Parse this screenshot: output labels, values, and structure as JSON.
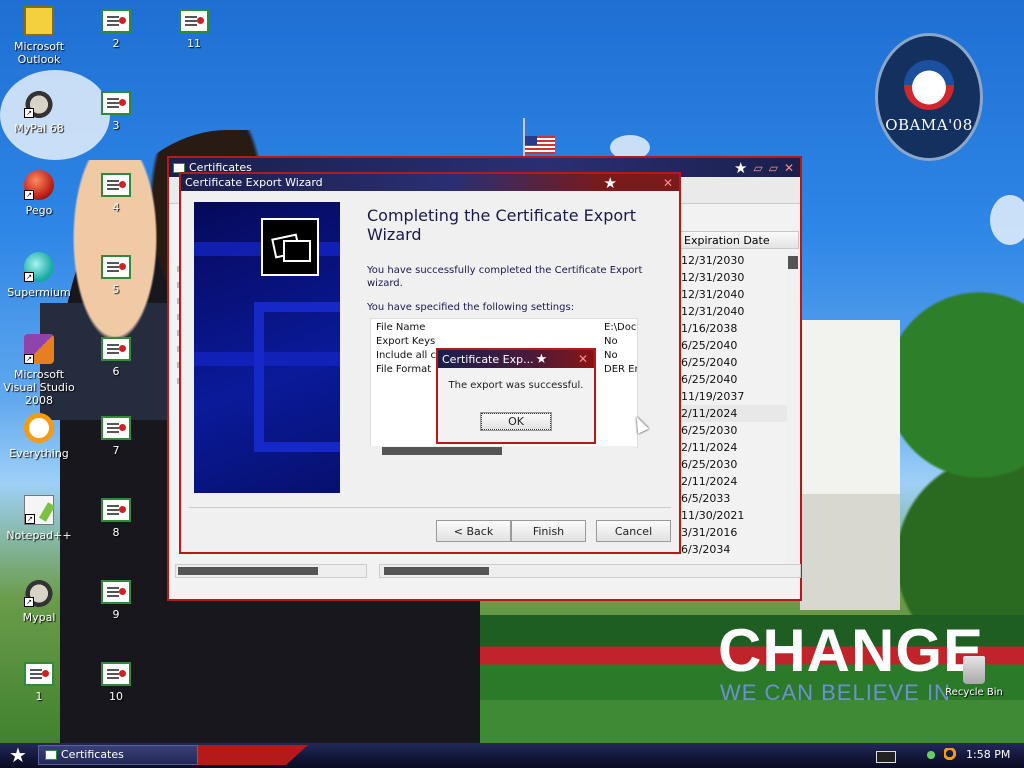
{
  "desktop": {
    "icons_col1": [
      {
        "label": "Microsoft Outlook",
        "icon": "outlook-icon"
      },
      {
        "label": "MyPal 68",
        "icon": "mypal-icon"
      },
      {
        "label": "Pego",
        "icon": "pego-icon"
      },
      {
        "label": "Supermium",
        "icon": "supermium-icon"
      },
      {
        "label": "Microsoft Visual Studio 2008",
        "icon": "visual-studio-icon"
      },
      {
        "label": "Everything",
        "icon": "everything-icon"
      },
      {
        "label": "Notepad++",
        "icon": "notepadpp-icon"
      },
      {
        "label": "Mypal",
        "icon": "mypal-icon"
      },
      {
        "label": "1",
        "icon": "certificate-icon"
      }
    ],
    "icons_col2": [
      "2",
      "3",
      "4",
      "5",
      "6",
      "7",
      "8",
      "9",
      "10"
    ],
    "icon_col3": "11",
    "recycle_bin": "Recycle Bin",
    "wallpaper": {
      "logo_text": "OBAMA'08",
      "slogan": "CHANGE",
      "subslogan": "WE CAN BELIEVE IN"
    }
  },
  "cert_window": {
    "title": "Certificates",
    "column_header": "Expiration Date",
    "expiration_dates": [
      "12/31/2030",
      "12/31/2030",
      "12/31/2040",
      "12/31/2040",
      "1/16/2038",
      "6/25/2040",
      "6/25/2040",
      "6/25/2040",
      "11/19/2037",
      "2/11/2024",
      "6/25/2030",
      "2/11/2024",
      "6/25/2030",
      "2/11/2024",
      "6/5/2033",
      "11/30/2021",
      "3/31/2016",
      "6/3/2034"
    ],
    "highlighted_row_index": 9
  },
  "wizard": {
    "title": "Certificate Export Wizard",
    "heading": "Completing the Certificate Export Wizard",
    "success_text": "You have successfully completed the Certificate Export wizard.",
    "settings_intro": "You have specified the following settings:",
    "settings": [
      {
        "name": "File Name",
        "value": "E:\\Doc"
      },
      {
        "name": "Export Keys",
        "value": "No"
      },
      {
        "name": "Include all ce",
        "value": "No"
      },
      {
        "name": "File Format",
        "value": "DER Er"
      }
    ],
    "buttons": {
      "back": "< Back",
      "finish": "Finish",
      "cancel": "Cancel"
    }
  },
  "message_box": {
    "title": "Certificate Exp...",
    "message": "The export was successful.",
    "ok": "OK"
  },
  "taskbar": {
    "task_label": "Certificates",
    "clock": "1:58 PM"
  },
  "colors": {
    "window_border": "#b51a1a",
    "titlebar": "#1a1f4d",
    "wizard_side": "#0a1a9a"
  }
}
